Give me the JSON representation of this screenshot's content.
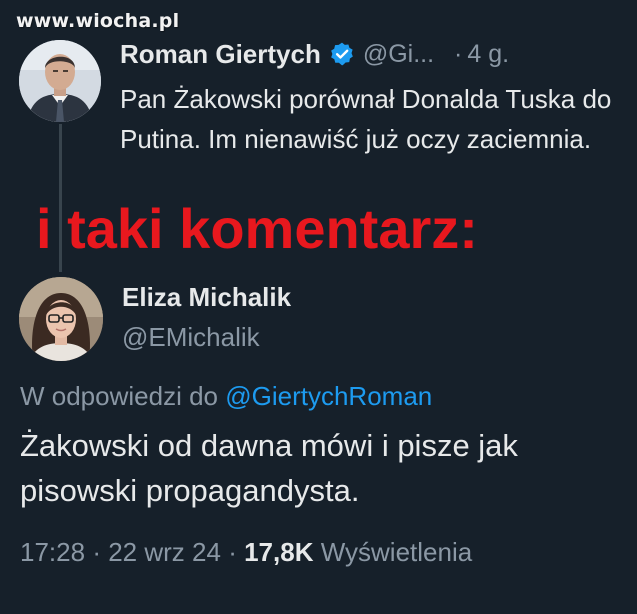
{
  "watermark": "www.wiocha.pl",
  "colors": {
    "background": "#16202a",
    "primary_text": "#e7e9ea",
    "secondary_text": "#8b98a5",
    "link": "#1d9bf0",
    "verified_badge": "#1d9bf0",
    "overlay_text": "#e8181e"
  },
  "parent_tweet": {
    "display_name": "Roman Giertych",
    "verified_icon": "verified-badge-icon",
    "handle": "@Gi...",
    "separator": "·",
    "time_ago": "4 g.",
    "text": "Pan Żakowski porównał Donalda Tuska do Putina. Im nienawiść już oczy zaciemnia."
  },
  "overlay_caption": "i taki komentarz:",
  "reply_tweet": {
    "display_name": "Eliza Michalik",
    "handle": "@EMichalik",
    "replying_to_prefix": "W odpowiedzi do",
    "replying_to_handle": "@GiertychRoman",
    "text": "Żakowski od dawna mówi i pisze jak pisowski propagandysta.",
    "time": "17:28",
    "date": "22 wrz 24",
    "separator": "·",
    "views_count": "17,8K",
    "views_label": "Wyświetlenia"
  }
}
